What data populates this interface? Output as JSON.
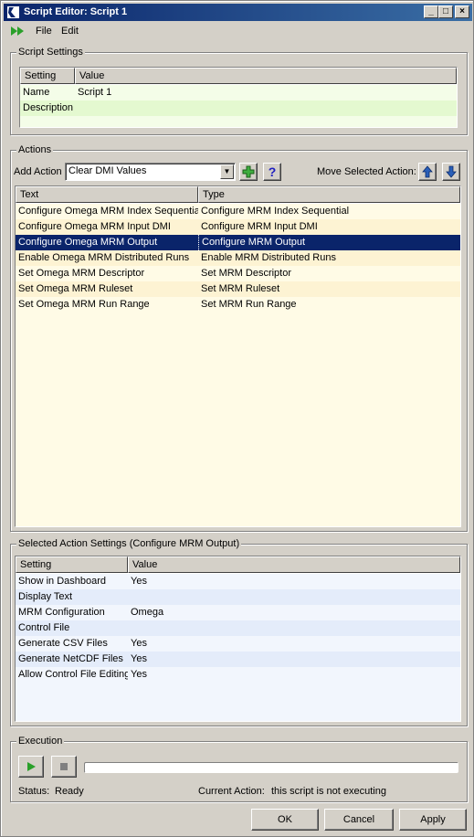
{
  "window": {
    "title": "Script Editor: Script 1"
  },
  "menu": {
    "file": "File",
    "edit": "Edit"
  },
  "script_settings": {
    "title": "Script Settings",
    "columns": [
      "Setting",
      "Value"
    ],
    "rows": [
      {
        "setting": "Name",
        "value": "Script 1"
      },
      {
        "setting": "Description",
        "value": ""
      }
    ]
  },
  "actions": {
    "title": "Actions",
    "add_action_label": "Add Action",
    "add_action_value": "Clear DMI Values",
    "move_label": "Move Selected Action:",
    "columns": [
      "Text",
      "Type"
    ],
    "rows": [
      {
        "text": "Configure Omega MRM Index Sequential",
        "type": "Configure MRM Index Sequential"
      },
      {
        "text": "Configure Omega MRM Input DMI",
        "type": "Configure MRM Input DMI"
      },
      {
        "text": "Configure Omega MRM Output",
        "type": "Configure MRM Output"
      },
      {
        "text": "Enable Omega MRM Distributed Runs",
        "type": "Enable MRM Distributed Runs"
      },
      {
        "text": "Set Omega MRM Descriptor",
        "type": "Set MRM Descriptor"
      },
      {
        "text": "Set Omega MRM Ruleset",
        "type": "Set MRM Ruleset"
      },
      {
        "text": "Set Omega MRM Run Range",
        "type": "Set MRM Run Range"
      }
    ],
    "selected_index": 2
  },
  "selected_settings": {
    "title": "Selected Action Settings (Configure MRM Output)",
    "columns": [
      "Setting",
      "Value"
    ],
    "rows": [
      {
        "setting": "Show in Dashboard",
        "value": "Yes"
      },
      {
        "setting": "Display Text",
        "value": ""
      },
      {
        "setting": "MRM Configuration",
        "value": "Omega"
      },
      {
        "setting": "Control File",
        "value": ""
      },
      {
        "setting": "Generate CSV Files",
        "value": "Yes"
      },
      {
        "setting": "Generate NetCDF Files",
        "value": "Yes"
      },
      {
        "setting": "Allow Control File Editing",
        "value": "Yes"
      }
    ]
  },
  "execution": {
    "title": "Execution",
    "status_label": "Status:",
    "status_value": "Ready",
    "current_label": "Current Action:",
    "current_value": "this script is not executing",
    "progress": 0
  },
  "buttons": {
    "ok": "OK",
    "cancel": "Cancel",
    "apply": "Apply"
  },
  "colors": {
    "title_start": "#0a246a",
    "selection": "#0a246a",
    "settings_row_a": "#f4fde8",
    "settings_row_b": "#e4f9d0",
    "action_row_a": "#fffbe6",
    "action_row_b": "#fdf3d3",
    "sel_row_a": "#f2f6fd",
    "sel_row_b": "#e4ecfa"
  }
}
